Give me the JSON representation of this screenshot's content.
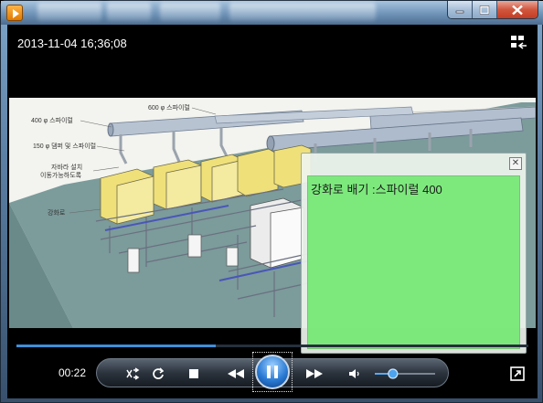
{
  "window": {
    "app_icon": "media-player-icon",
    "buttons": {
      "minimize": "minimize-icon",
      "maximize": "maximize-icon",
      "close": "close-icon"
    }
  },
  "player": {
    "timestamp": "2013-11-04 16;36;08",
    "elapsed": "00:22",
    "seek_progress": 0.39,
    "volume_level": 0.3
  },
  "video": {
    "labels": {
      "top_pipe": "600 φ 스파이럴",
      "pipe_400": "400 φ 스파이럴",
      "damper": "150 φ 댐퍼 및 스파이럴",
      "moveable_1": "자바라 설치",
      "moveable_2": "이동가능하도록",
      "furnace": "강화로"
    }
  },
  "popup": {
    "title": "강화로 배기 :스파이럴 400"
  },
  "colors": {
    "accent": "#3f8fd9",
    "popup_green": "#6ee86e",
    "floor": "#7a9a99",
    "cabinet": "#efe07a"
  }
}
